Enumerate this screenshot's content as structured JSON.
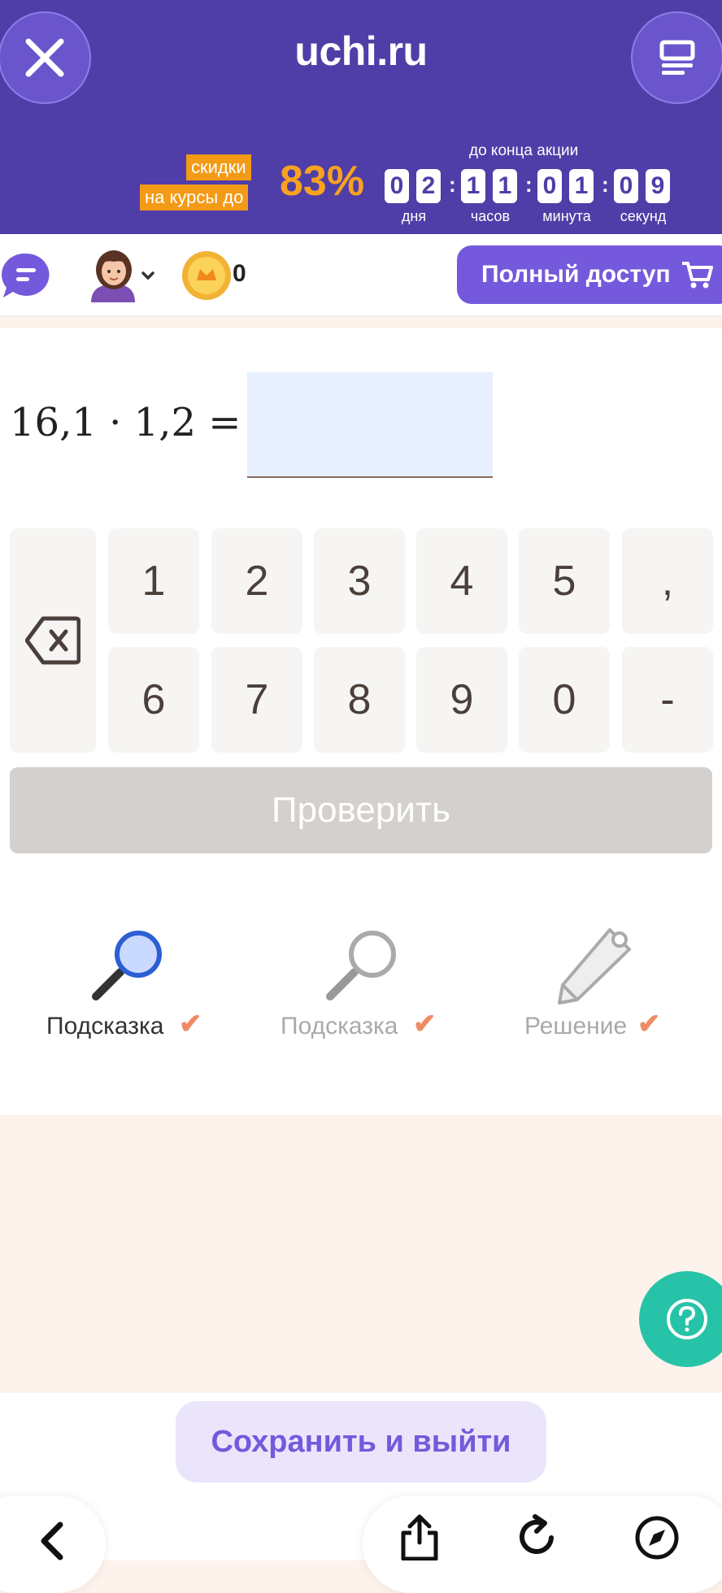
{
  "header": {
    "logo": "uchi.ru",
    "promo_line1": "скидки",
    "promo_line2": "на курсы до",
    "promo_percent": "83%",
    "countdown_caption": "до конца акции",
    "countdown": {
      "days": [
        "0",
        "2"
      ],
      "hours": [
        "1",
        "1"
      ],
      "minutes": [
        "0",
        "1"
      ],
      "seconds": [
        "0",
        "9"
      ],
      "labels": [
        "дня",
        "часов",
        "минута",
        "секунд"
      ]
    }
  },
  "toolbar": {
    "coins": "0",
    "full_access_label": "Полный доступ"
  },
  "task": {
    "expression": "16,1 · 1,2 =",
    "answer_value": ""
  },
  "keypad": {
    "row1": [
      "1",
      "2",
      "3",
      "4",
      "5",
      ","
    ],
    "row2": [
      "6",
      "7",
      "8",
      "9",
      "0",
      "-"
    ]
  },
  "check_label": "Проверить",
  "hints": [
    {
      "label": "Подсказка"
    },
    {
      "label": "Подсказка"
    },
    {
      "label": "Решение"
    }
  ],
  "save_exit_label": "Сохранить и выйти",
  "colors": {
    "header": "#4f3ea8",
    "accent": "#7459dc",
    "promo": "#f39a16",
    "help": "#27c3a8"
  }
}
